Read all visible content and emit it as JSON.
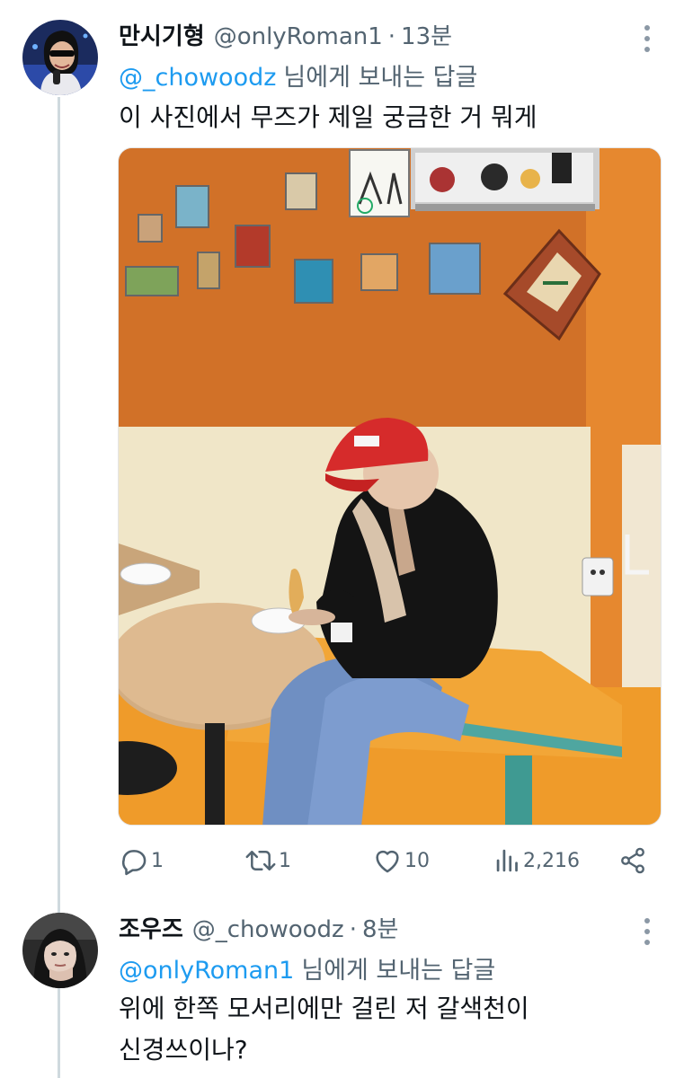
{
  "tweet1": {
    "name": "만시기형",
    "handle": "@onlyRoman1",
    "separator": "·",
    "time": "13분",
    "reply_to_handle": "@_chowoodz",
    "reply_to_suffix": "님에게 보내는 답글",
    "text": "이 사진에서 무즈가 제일 궁금한 거 뭐게",
    "actions": {
      "reply_count": "1",
      "retweet_count": "1",
      "like_count": "10",
      "view_count": "2,216"
    }
  },
  "tweet2": {
    "name": "조우즈",
    "handle": "@_chowoodz",
    "separator": "·",
    "time": "8분",
    "reply_to_handle": "@onlyRoman1",
    "reply_to_suffix": "님에게 보내는 답글",
    "text_line1": "위에 한쪽 모서리에만 걸린 저 갈색천이",
    "text_line2": "신경쓰이나?"
  },
  "colors": {
    "accent": "#1d9bf0",
    "secondary_text": "#536471",
    "thread_line": "#cfd9de",
    "cap_red": "#d62b2b",
    "wall_orange": "#d9722e"
  },
  "icons": [
    "more-icon",
    "reply-icon",
    "retweet-icon",
    "like-icon",
    "views-icon",
    "share-icon"
  ]
}
